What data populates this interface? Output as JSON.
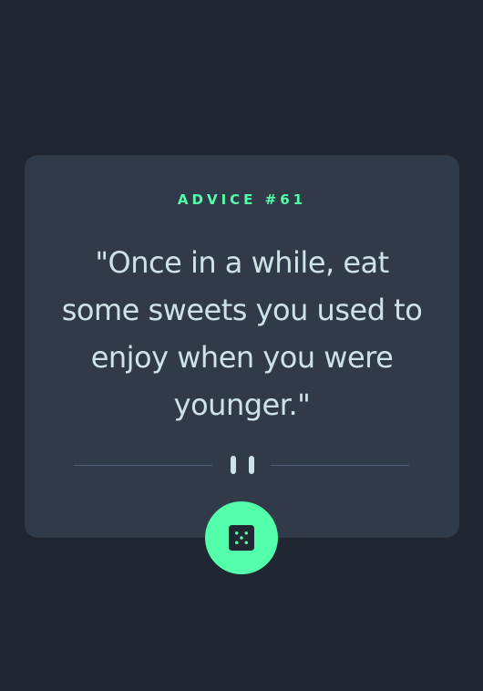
{
  "advice": {
    "title": "ADVICE #61",
    "quote": "\"Once in a while, eat some sweets you used to enjoy when you were younger.\""
  },
  "icons": {
    "divider": "pause-icon",
    "button": "dice-icon"
  },
  "colors": {
    "background": "#202733",
    "card": "#313a48",
    "accent": "#53ffaa",
    "text": "#cee3e9",
    "divider": "#4f5d74"
  }
}
